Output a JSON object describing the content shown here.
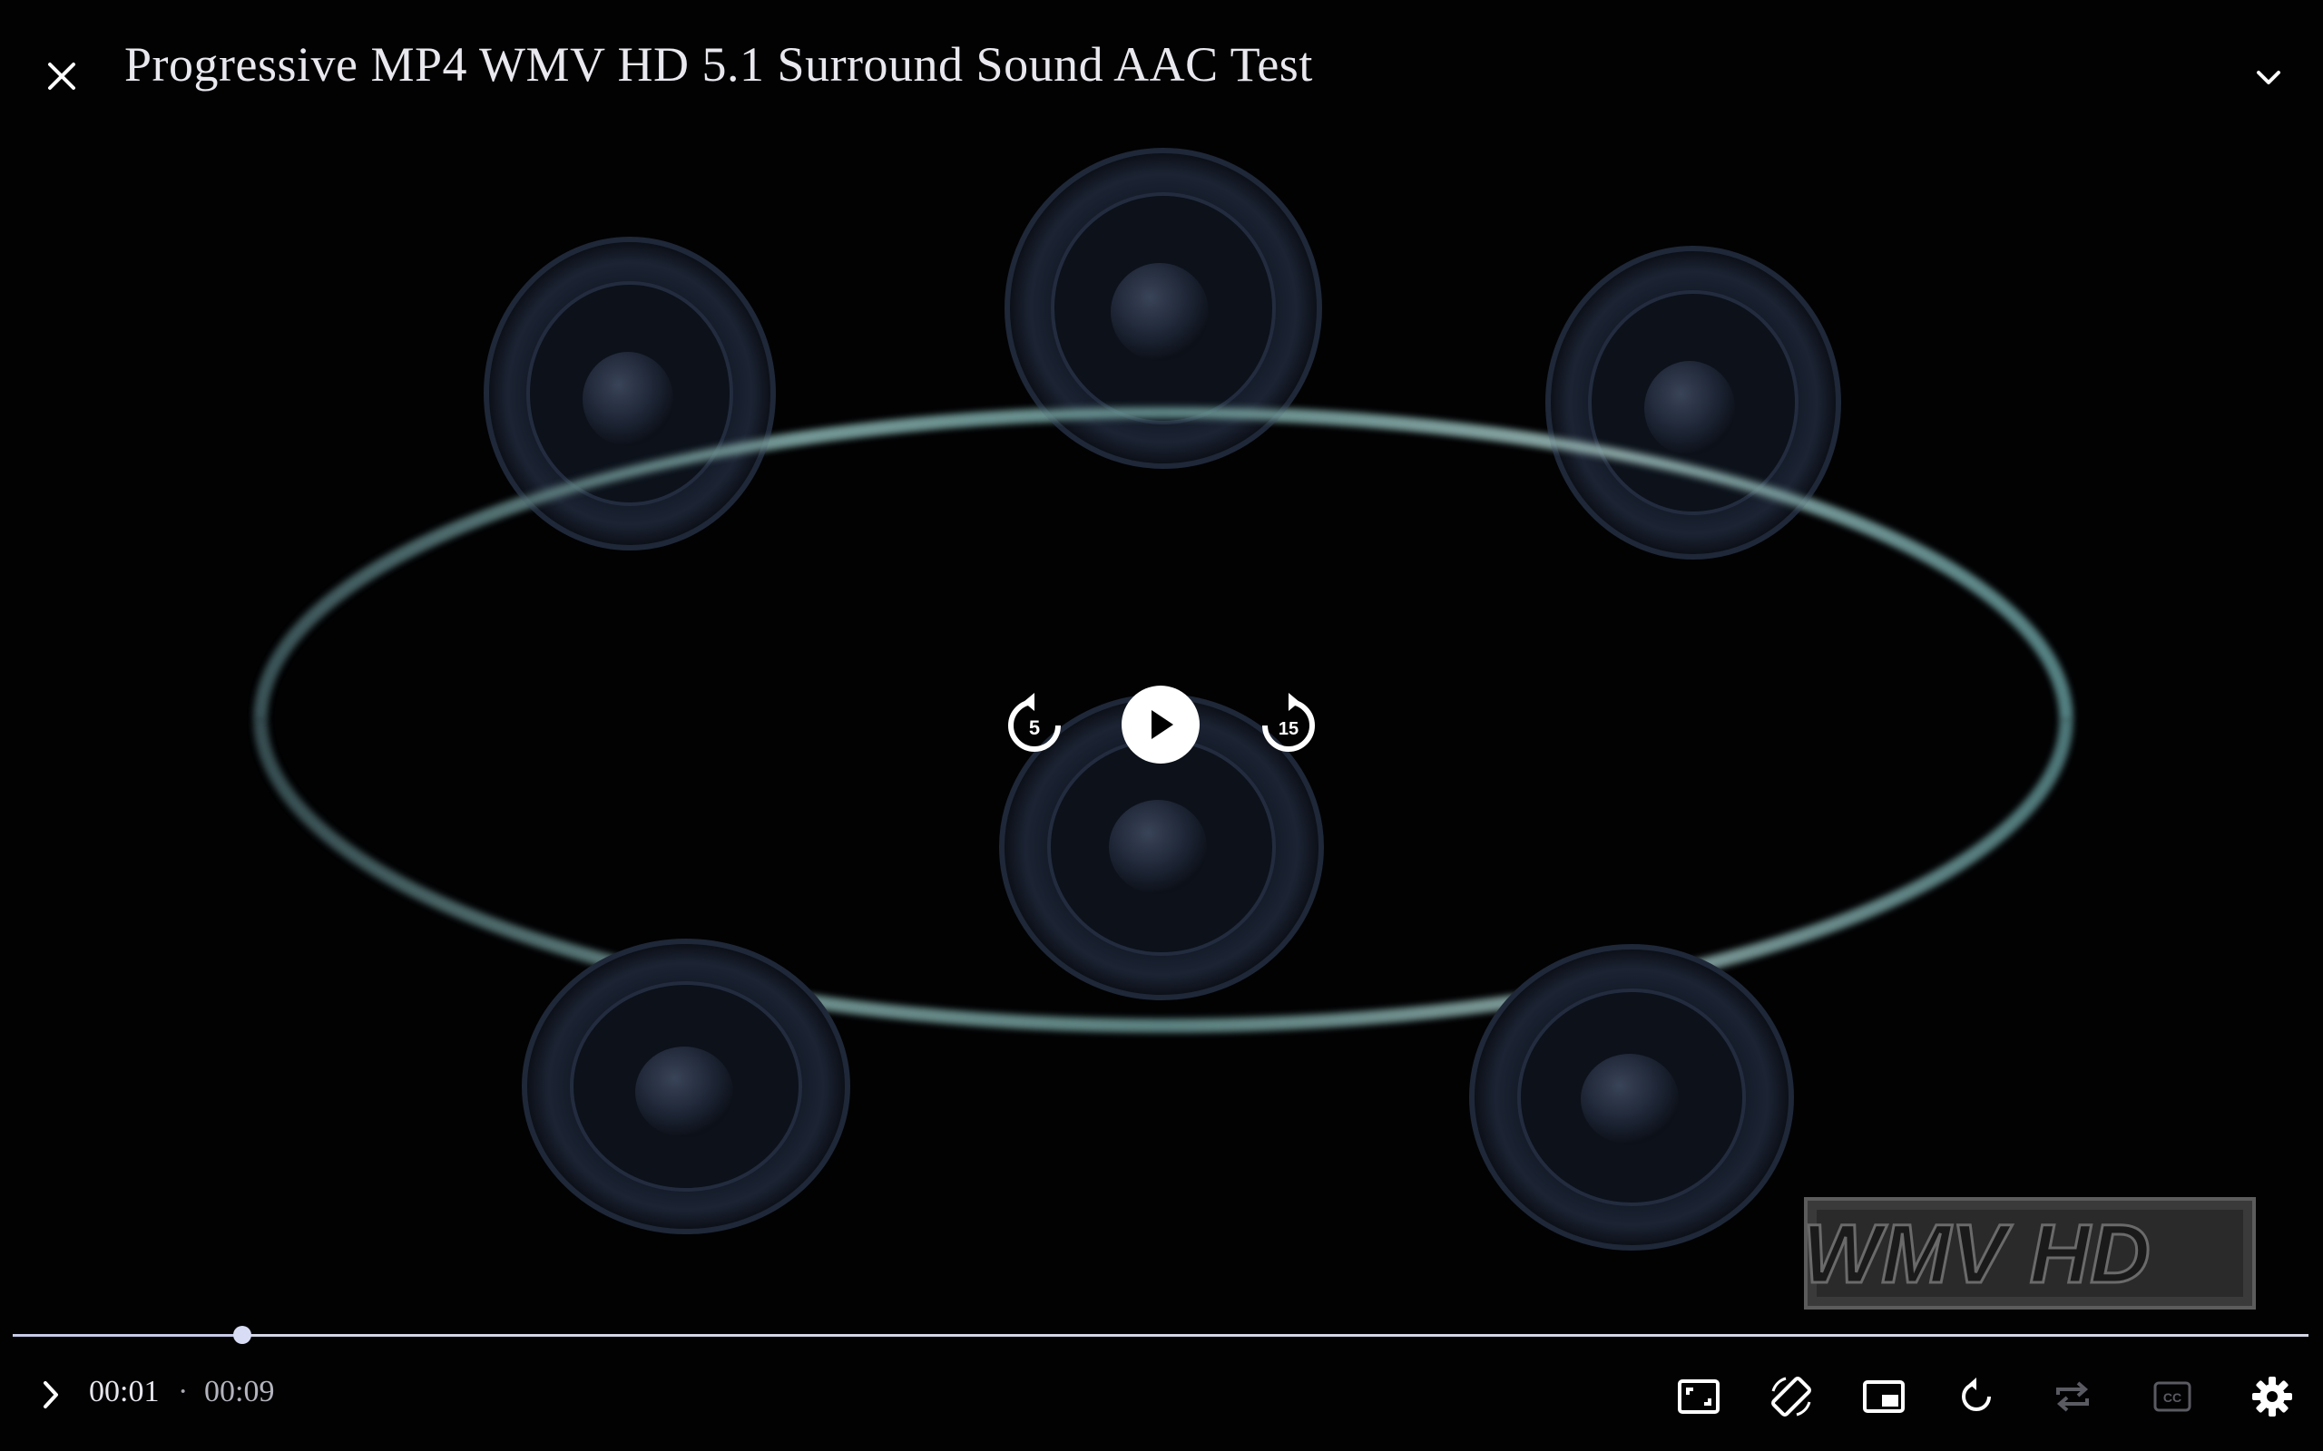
{
  "player": {
    "title": "Progressive MP4 WMV HD 5.1 Surround Sound AAC Test",
    "current_time": "00:01",
    "separator": "·",
    "total_time": "00:09",
    "progress_fraction": 0.1
  },
  "center_controls": {
    "rewind_seconds": "5",
    "forward_seconds": "15"
  },
  "watermark": {
    "text": "WMV HD"
  },
  "icons": {
    "close": "close-icon",
    "collapse": "chevron-down-icon",
    "rewind": "replay-5-icon",
    "play": "play-icon",
    "forward": "forward-15-icon",
    "expand": "chevron-right-icon",
    "aspect": "aspect-ratio-icon",
    "rotate": "screen-rotation-icon",
    "pip": "picture-in-picture-icon",
    "restart": "replay-icon",
    "repeat": "repeat-icon",
    "cc": "closed-captions-icon",
    "settings": "gear-icon"
  },
  "colors": {
    "background": "#020203",
    "text": "#e8e8ee",
    "progress": "#c7cbe8",
    "disabled_icon": "#5a5a62"
  }
}
